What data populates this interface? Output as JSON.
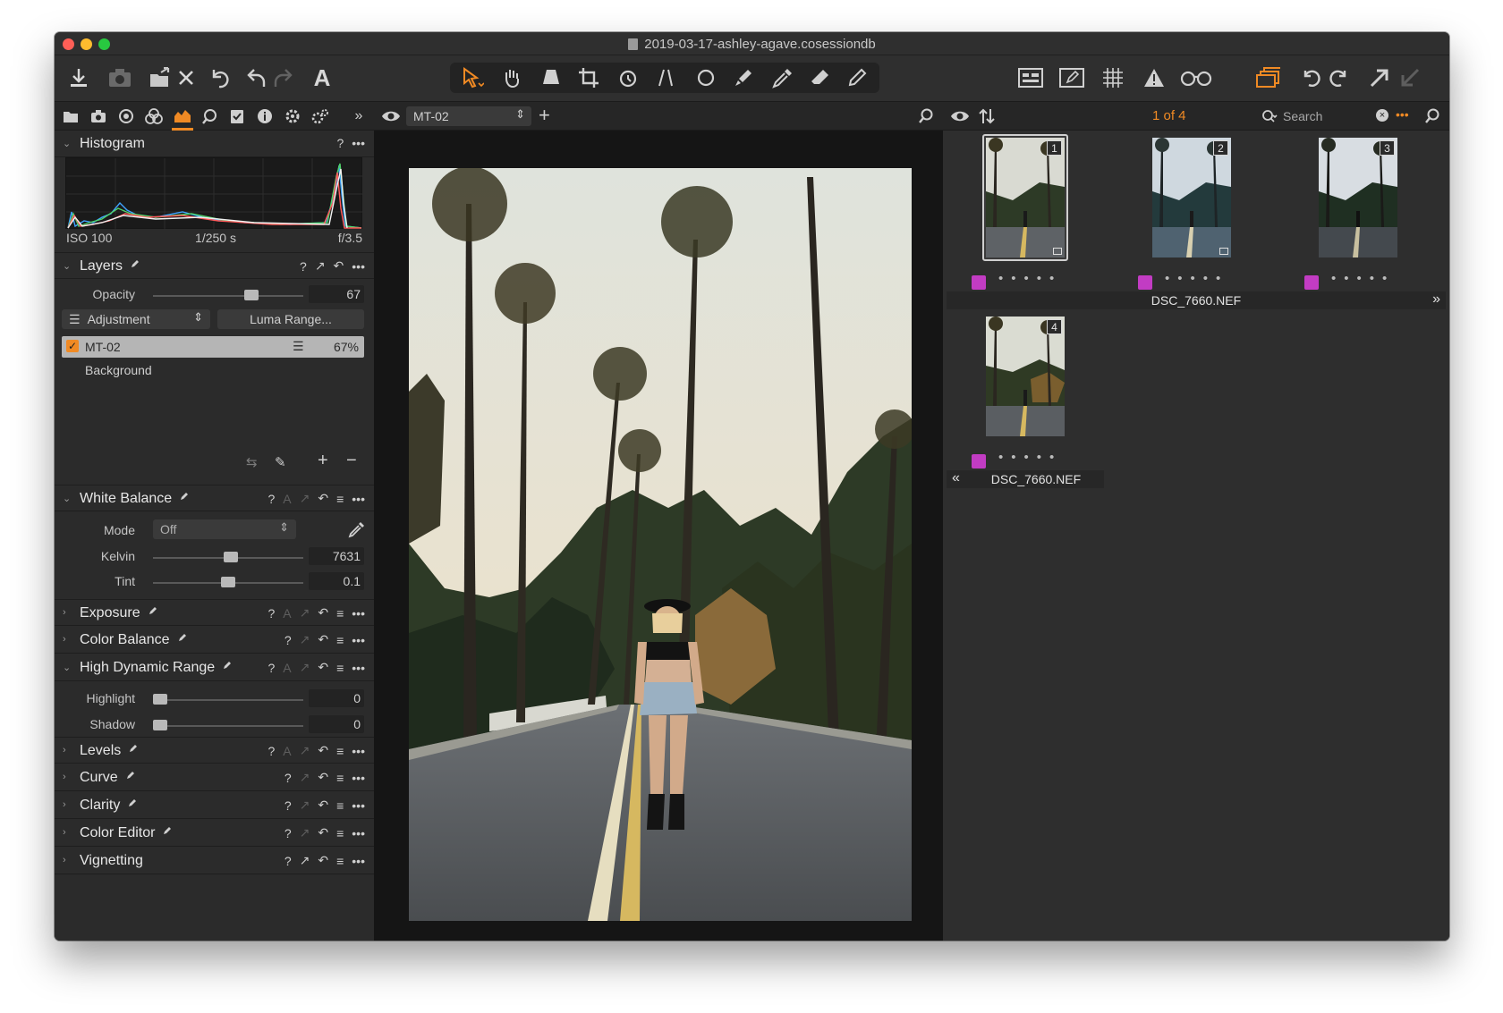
{
  "window": {
    "title": "2019-03-17-ashley-agave.cosessiondb",
    "traffic_colors": [
      "#fe5f57",
      "#febc2e",
      "#28c840"
    ]
  },
  "toolbar": {
    "left_icons": [
      "import-icon",
      "camera-icon",
      "move-to-icon",
      "delete-icon",
      "reset-icon",
      "undo-icon",
      "redo-icon",
      "text-icon"
    ],
    "center_icons": [
      "select-cursor-icon",
      "pan-icon",
      "keystone-icon",
      "crop-icon",
      "rotate-icon",
      "straighten-icon",
      "circle-icon",
      "brush-icon",
      "eyedropper-icon",
      "erase-icon",
      "gradient-icon"
    ],
    "right_icons": [
      "layout-icon",
      "edit-icon",
      "grid-icon",
      "warning-icon",
      "glasses-icon",
      "stack-icon",
      "rotate-left-icon",
      "rotate-right-icon",
      "export-icon",
      "collapse-icon"
    ]
  },
  "left": {
    "tool_tabs": [
      "library-icon",
      "capture-icon",
      "lens-icon",
      "color-icon",
      "exposure-icon",
      "details-icon",
      "adjustments-icon",
      "metadata-icon",
      "output-icon",
      "batch-icon"
    ],
    "histogram": {
      "title": "Histogram",
      "help": "?",
      "iso": "ISO 100",
      "shutter": "1/250 s",
      "aperture": "f/3.5"
    },
    "layers": {
      "title": "Layers",
      "help": "?",
      "opacity_label": "Opacity",
      "opacity_value": "67",
      "opacity_fraction": 0.67,
      "adjust_select": "Adjustment",
      "luma_button": "Luma Range...",
      "layer_name": "MT-02",
      "layer_pct": "67%",
      "background": "Background"
    },
    "white_balance": {
      "title": "White Balance",
      "help": "?",
      "auto": "A",
      "mode_label": "Mode",
      "mode_value": "Off",
      "kelvin_label": "Kelvin",
      "kelvin_value": "7631",
      "kelvin_fraction": 0.52,
      "tint_label": "Tint",
      "tint_value": "0.1",
      "tint_fraction": 0.5
    },
    "exposure": {
      "title": "Exposure",
      "help": "?",
      "auto": "A"
    },
    "color_balance": {
      "title": "Color Balance",
      "help": "?"
    },
    "hdr": {
      "title": "High Dynamic Range",
      "help": "?",
      "auto": "A",
      "highlight_label": "Highlight",
      "highlight_value": "0",
      "shadow_label": "Shadow",
      "shadow_value": "0"
    },
    "levels": {
      "title": "Levels",
      "help": "?",
      "auto": "A"
    },
    "curve": {
      "title": "Curve",
      "help": "?"
    },
    "clarity": {
      "title": "Clarity",
      "help": "?"
    },
    "color_editor": {
      "title": "Color Editor",
      "help": "?"
    },
    "vignetting": {
      "title": "Vignetting",
      "help": "?"
    }
  },
  "viewer": {
    "layer_select": "MT-02"
  },
  "browser": {
    "count": "1 of 4",
    "search_placeholder": "Search",
    "accent": "#f08a24",
    "color_tag": "#c23cc3",
    "thumbs": [
      {
        "num": "1"
      },
      {
        "num": "2"
      },
      {
        "num": "3"
      },
      {
        "num": "4"
      }
    ],
    "row1_filename": "DSC_7660.NEF",
    "row2_filename": "DSC_7660.NEF",
    "next_arrow": "»",
    "prev_arrow": "«"
  }
}
